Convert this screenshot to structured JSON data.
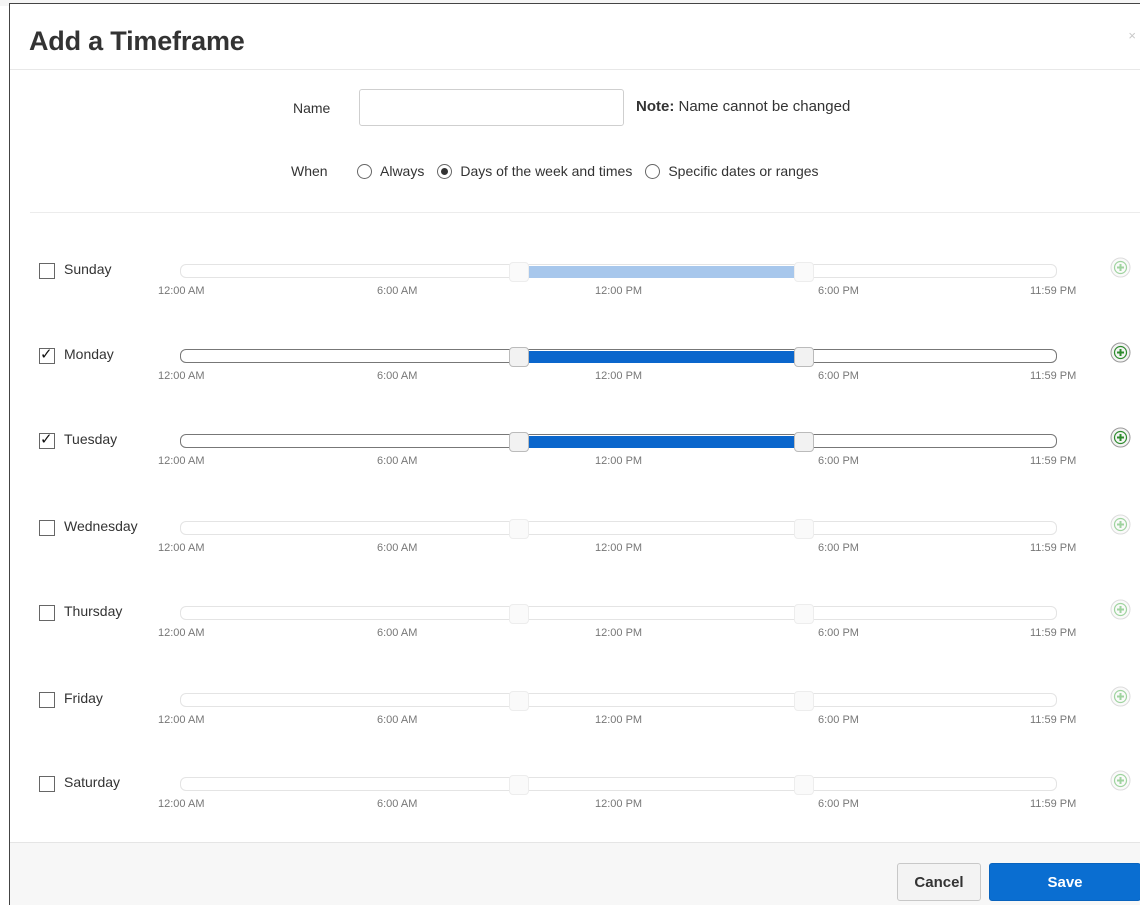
{
  "modal": {
    "title": "Add a Timeframe",
    "close_symbol": "×"
  },
  "form": {
    "name_label": "Name",
    "name_value": "",
    "name_placeholder": "",
    "note_bold": "Note:",
    "note_text": " Name cannot be changed",
    "when_label": "When",
    "when_options": [
      {
        "label": "Always",
        "selected": false
      },
      {
        "label": "Days of the week and times",
        "selected": true
      },
      {
        "label": "Specific dates or ranges",
        "selected": false
      }
    ]
  },
  "tick_labels": [
    "12:00 AM",
    "6:00 AM",
    "12:00 PM",
    "6:00 PM",
    "11:59 PM"
  ],
  "time_scale": {
    "min_hours": 0,
    "max_hours": 24
  },
  "days": [
    {
      "label": "Sunday",
      "checked": false,
      "range_start_hours": 9,
      "range_end_hours": 17,
      "range_color": "#a7c7ec"
    },
    {
      "label": "Monday",
      "checked": true,
      "range_start_hours": 9,
      "range_end_hours": 17,
      "range_color": "#0a66cc"
    },
    {
      "label": "Tuesday",
      "checked": true,
      "range_start_hours": 9,
      "range_end_hours": 17,
      "range_color": "#0a66cc"
    },
    {
      "label": "Wednesday",
      "checked": false,
      "range_start_hours": 9,
      "range_end_hours": 17,
      "range_color": null
    },
    {
      "label": "Thursday",
      "checked": false,
      "range_start_hours": 9,
      "range_end_hours": 17,
      "range_color": null
    },
    {
      "label": "Friday",
      "checked": false,
      "range_start_hours": 9,
      "range_end_hours": 17,
      "range_color": null
    },
    {
      "label": "Saturday",
      "checked": false,
      "range_start_hours": 9,
      "range_end_hours": 17,
      "range_color": null
    }
  ],
  "icons": {
    "add": "plus-circle-icon",
    "close": "close-icon"
  },
  "colors": {
    "primary": "#0a6ed1",
    "add_active": "#2e8b2e",
    "add_inactive": "#9fd39f"
  },
  "footer": {
    "cancel_label": "Cancel",
    "save_label": "Save"
  }
}
